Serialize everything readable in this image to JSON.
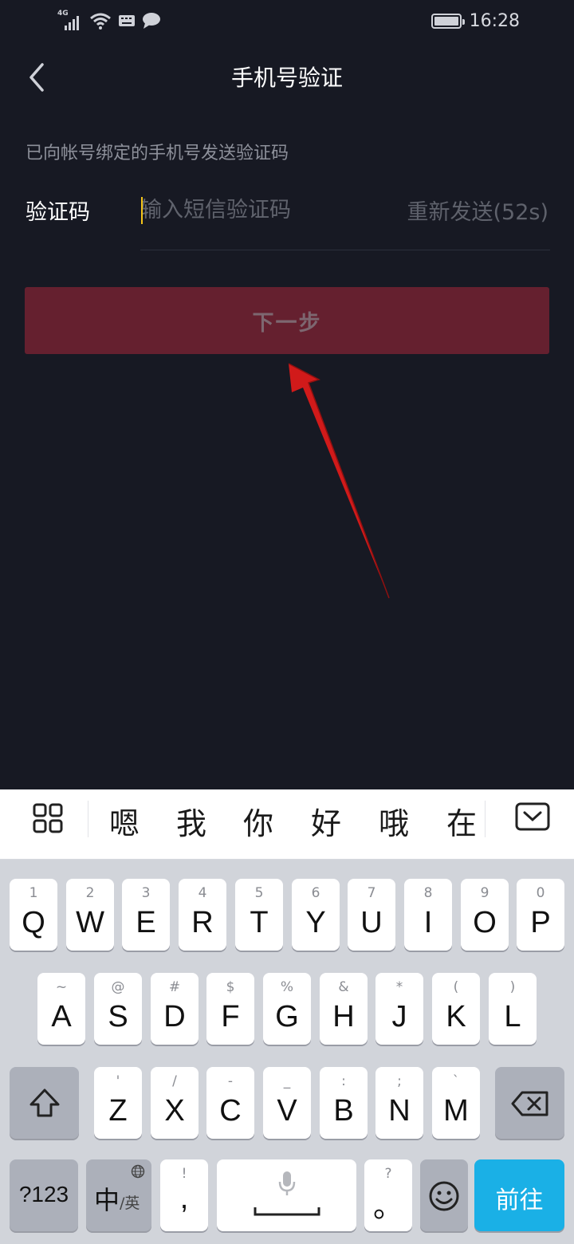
{
  "status_bar": {
    "network": "4G",
    "time": "16:28"
  },
  "header": {
    "title": "手机号验证"
  },
  "form": {
    "hint": "已向帐号绑定的手机号发送验证码",
    "code_label": "验证码",
    "code_placeholder": "输入短信验证码",
    "code_value": "",
    "resend_label": "重新发送(52s)",
    "next_label": "下一步"
  },
  "colors": {
    "background": "#171923",
    "next_button": "#65202f",
    "annotation_arrow": "#d11a1a",
    "cursor": "#f5c518",
    "go_key": "#1ab0e6"
  },
  "candidates": [
    "嗯",
    "我",
    "你",
    "好",
    "哦",
    "在"
  ],
  "keyboard": {
    "row1": [
      {
        "sub": "1",
        "main": "Q"
      },
      {
        "sub": "2",
        "main": "W"
      },
      {
        "sub": "3",
        "main": "E"
      },
      {
        "sub": "4",
        "main": "R"
      },
      {
        "sub": "5",
        "main": "T"
      },
      {
        "sub": "6",
        "main": "Y"
      },
      {
        "sub": "7",
        "main": "U"
      },
      {
        "sub": "8",
        "main": "I"
      },
      {
        "sub": "9",
        "main": "O"
      },
      {
        "sub": "0",
        "main": "P"
      }
    ],
    "row2": [
      {
        "sub": "~",
        "main": "A"
      },
      {
        "sub": "@",
        "main": "S"
      },
      {
        "sub": "#",
        "main": "D"
      },
      {
        "sub": "$",
        "main": "F"
      },
      {
        "sub": "%",
        "main": "G"
      },
      {
        "sub": "&",
        "main": "H"
      },
      {
        "sub": "*",
        "main": "J"
      },
      {
        "sub": "(",
        "main": "K"
      },
      {
        "sub": ")",
        "main": "L"
      }
    ],
    "row3": [
      {
        "sub": "'",
        "main": "Z"
      },
      {
        "sub": "/",
        "main": "X"
      },
      {
        "sub": "-",
        "main": "C"
      },
      {
        "sub": "_",
        "main": "V"
      },
      {
        "sub": ":",
        "main": "B"
      },
      {
        "sub": ";",
        "main": "N"
      },
      {
        "sub": "`",
        "main": "M"
      }
    ],
    "num_switch": "?123",
    "lang_main": "中",
    "lang_alt": "/英",
    "comma_sub": "!",
    "comma_main": ",",
    "period_sub": "?",
    "period_main": "。",
    "go_label": "前往"
  },
  "icons": {
    "back": "chevron-left-icon",
    "shift": "shift-icon",
    "backspace": "backspace-icon",
    "mic": "microphone-icon",
    "emoji": "emoji-icon",
    "globe": "globe-icon",
    "grid": "grid-icon",
    "collapse": "keyboard-collapse-icon"
  }
}
